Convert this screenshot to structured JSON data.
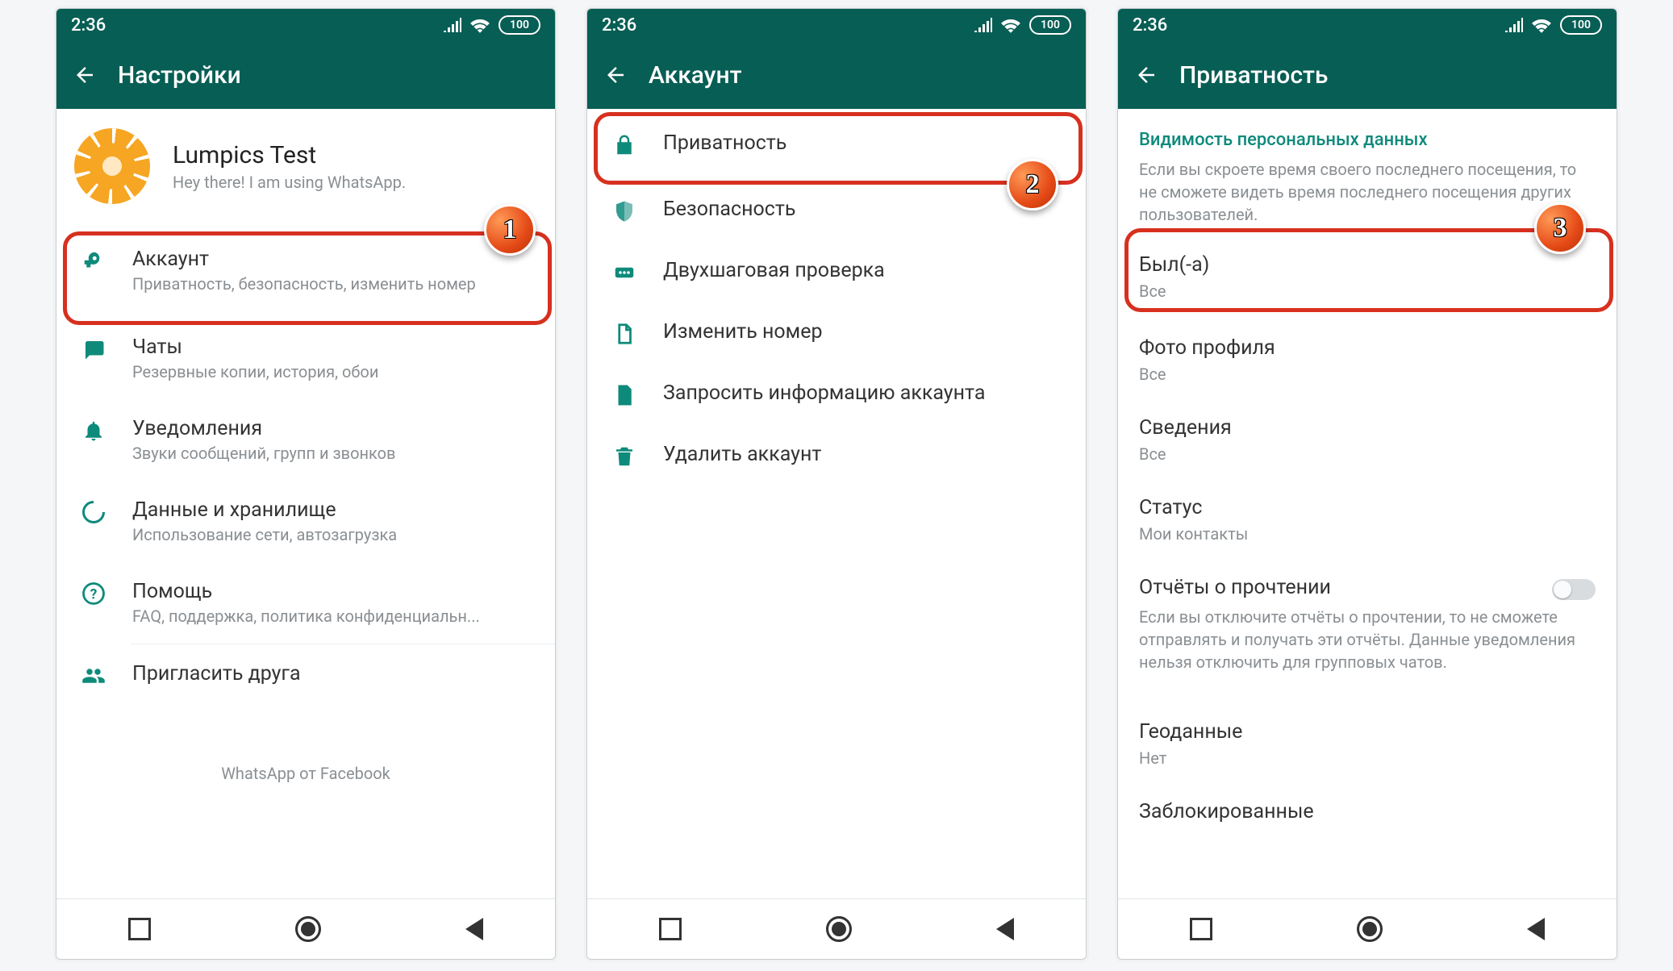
{
  "status": {
    "time": "2:36",
    "battery": "100"
  },
  "screens": [
    {
      "title": "Настройки",
      "profile": {
        "name": "Lumpics Test",
        "status": "Hey there! I am using WhatsApp."
      },
      "items": [
        {
          "icon": "key",
          "title": "Аккаунт",
          "sub": "Приватность, безопасность, изменить номер"
        },
        {
          "icon": "chat",
          "title": "Чаты",
          "sub": "Резервные копии, история, обои"
        },
        {
          "icon": "bell",
          "title": "Уведомления",
          "sub": "Звуки сообщений, групп и звонков"
        },
        {
          "icon": "data",
          "title": "Данные и хранилище",
          "sub": "Использование сети, автозагрузка"
        },
        {
          "icon": "help",
          "title": "Помощь",
          "sub": "FAQ, поддержка, политика конфиденциальн..."
        },
        {
          "icon": "invite",
          "title": "Пригласить друга",
          "sub": ""
        }
      ],
      "footer": "WhatsApp от Facebook",
      "badge": "1"
    },
    {
      "title": "Аккаунт",
      "items": [
        {
          "icon": "lock",
          "title": "Приватность"
        },
        {
          "icon": "shield",
          "title": "Безопасность"
        },
        {
          "icon": "twostep",
          "title": "Двухшаговая проверка"
        },
        {
          "icon": "sim",
          "title": "Изменить номер"
        },
        {
          "icon": "doc",
          "title": "Запросить информацию аккаунта"
        },
        {
          "icon": "trash",
          "title": "Удалить аккаунт"
        }
      ],
      "badge": "2"
    },
    {
      "title": "Приватность",
      "header": "Видимость персональных данных",
      "desc": "Если вы скроете время своего последнего посещения, то не сможете видеть время последнего посещения других пользователей.",
      "items": [
        {
          "title": "Был(-а)",
          "sub": "Все"
        },
        {
          "title": "Фото профиля",
          "sub": "Все"
        },
        {
          "title": "Сведения",
          "sub": "Все"
        },
        {
          "title": "Статус",
          "sub": "Мои контакты"
        },
        {
          "title": "Отчёты о прочтении",
          "note": "Если вы отключите отчёты о прочтении, то не сможете отправлять и получать эти отчёты. Данные уведомления нельзя отключить для групповых чатов.",
          "toggle": true
        },
        {
          "title": "Геоданные",
          "sub": "Нет"
        },
        {
          "title": "Заблокированные"
        }
      ],
      "badge": "3"
    }
  ]
}
